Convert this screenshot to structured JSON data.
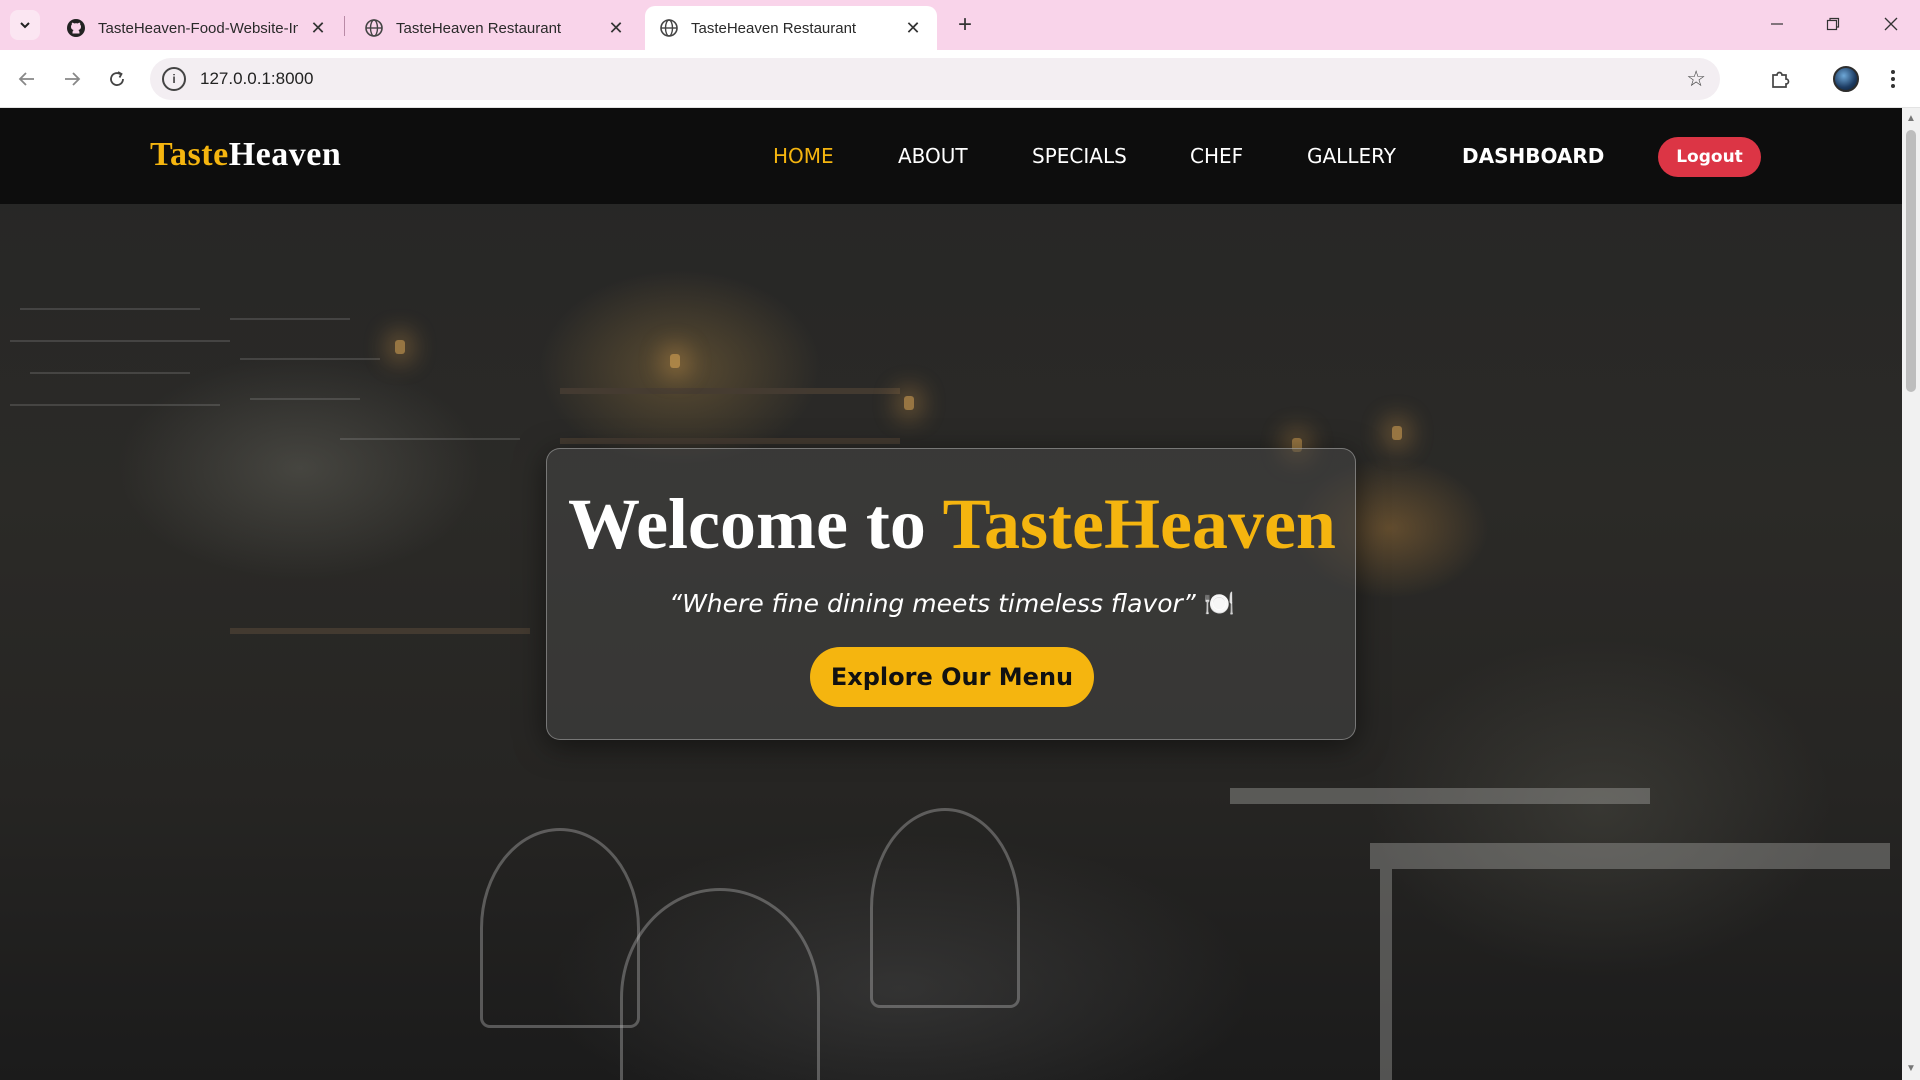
{
  "browser": {
    "tabs": [
      {
        "title": "TasteHeaven-Food-Website-In-Django",
        "favicon": "github-icon",
        "active": false
      },
      {
        "title": "TasteHeaven Restaurant",
        "favicon": "globe-icon",
        "active": false
      },
      {
        "title": "TasteHeaven Restaurant",
        "favicon": "globe-icon",
        "active": true
      }
    ],
    "url": "127.0.0.1:8000"
  },
  "site": {
    "brand_part1": "Taste",
    "brand_part2": "Heaven",
    "nav": [
      "HOME",
      "ABOUT",
      "SPECIALS",
      "CHEF",
      "GALLERY",
      "DASHBOARD"
    ],
    "active_nav": "HOME",
    "logout_label": "Logout",
    "colors": {
      "accent": "#f5b50f",
      "logout": "#dc3545",
      "header": "#0c0c0c"
    }
  },
  "hero": {
    "title_prefix": "Welcome to ",
    "title_accent": "TasteHeaven",
    "tagline": "“Where fine dining meets timeless flavor”",
    "tagline_emoji": "🍽️",
    "cta_label": "Explore Our Menu"
  }
}
